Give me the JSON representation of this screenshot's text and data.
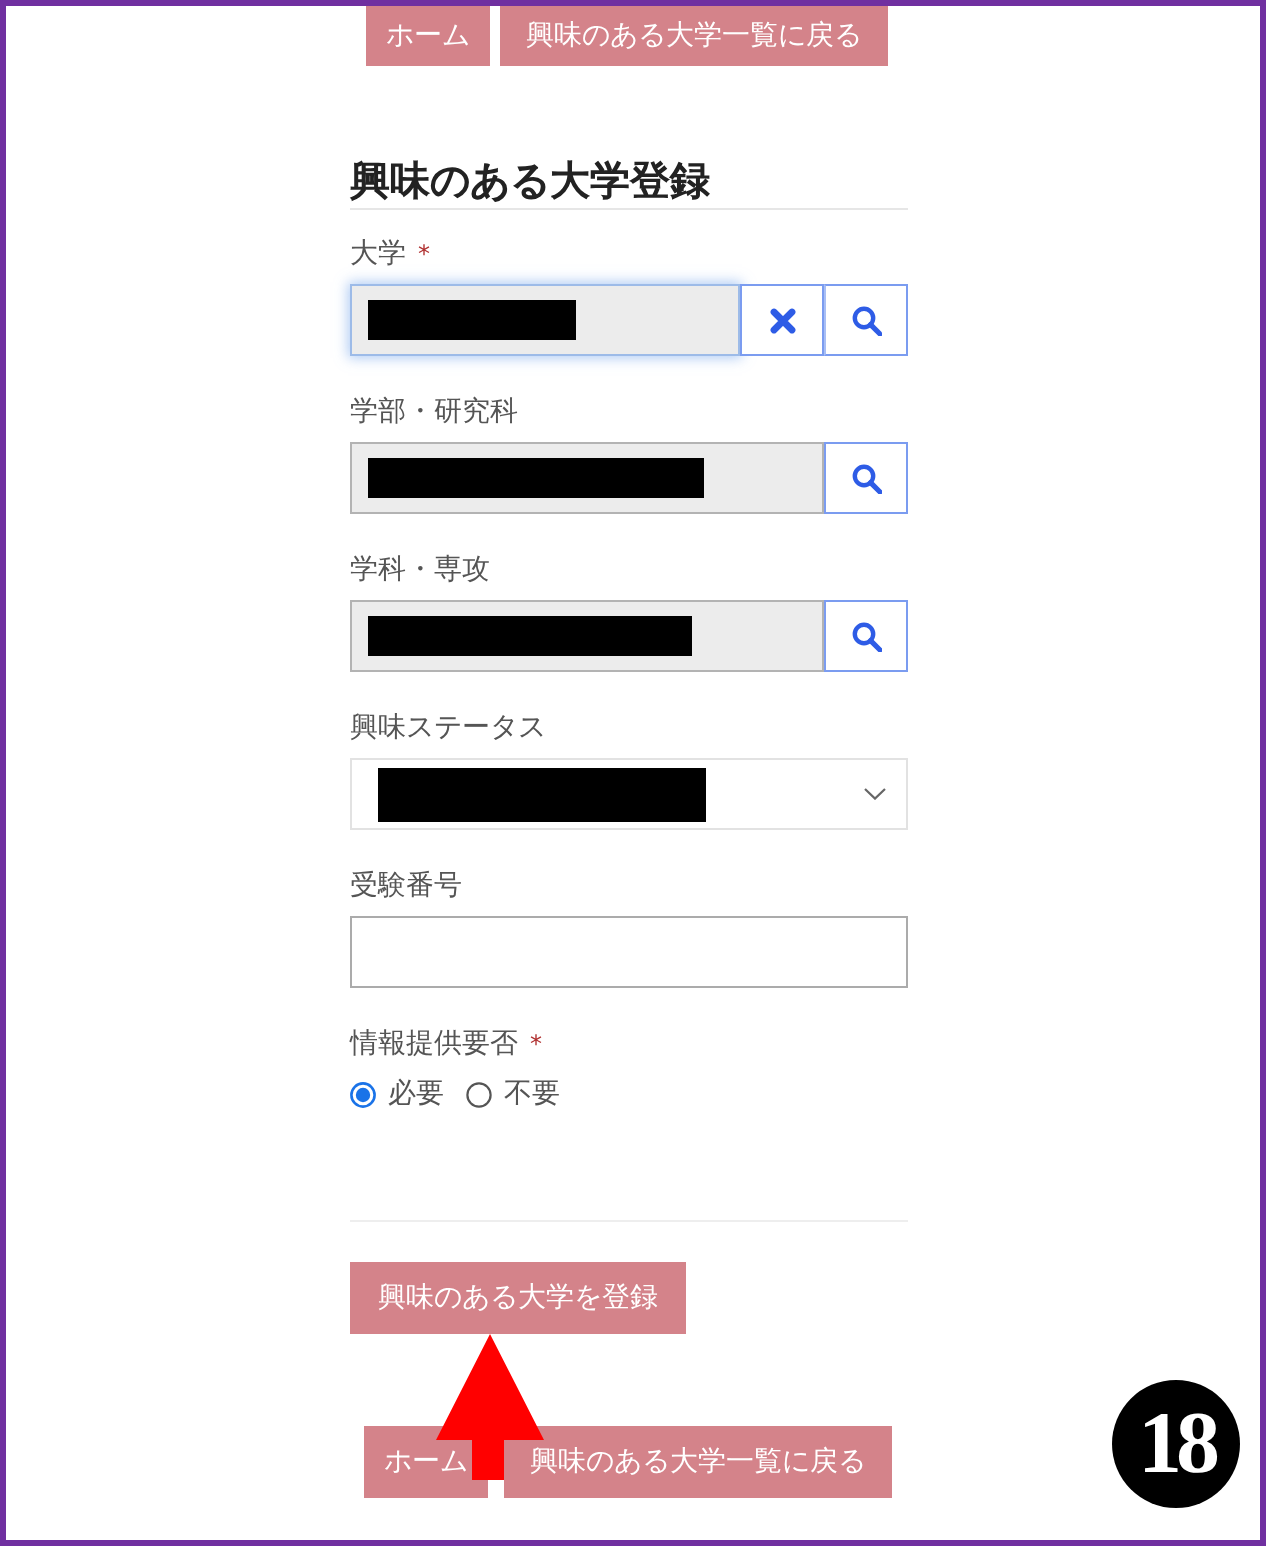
{
  "top_nav": [
    {
      "label": "ホーム"
    },
    {
      "label": "興味のある大学一覧に戻る"
    }
  ],
  "form": {
    "title": "興味のある大学登録",
    "fields": [
      {
        "kind": "lookup",
        "label": "大学",
        "required_mark": "*",
        "redacted": true,
        "clearable": true,
        "focused": true
      },
      {
        "kind": "lookup",
        "label": "学部・研究科",
        "redacted": true,
        "clearable": false,
        "focused": false
      },
      {
        "kind": "lookup",
        "label": "学科・専攻",
        "redacted": true,
        "clearable": false,
        "focused": false
      },
      {
        "kind": "select",
        "label": "興味ステータス",
        "redacted": true
      },
      {
        "kind": "text",
        "label": "受験番号"
      },
      {
        "kind": "radio",
        "label": "情報提供要否",
        "required_mark": "*",
        "options": [
          {
            "label": "必要",
            "selected": true
          },
          {
            "label": "不要",
            "selected": false
          }
        ]
      }
    ],
    "submit": "興味のある大学を登録"
  },
  "bottom_nav": [
    {
      "label": "ホーム"
    },
    {
      "label": "興味のある大学一覧に戻る"
    }
  ],
  "annotation": {
    "arrow": true,
    "step": "18"
  }
}
